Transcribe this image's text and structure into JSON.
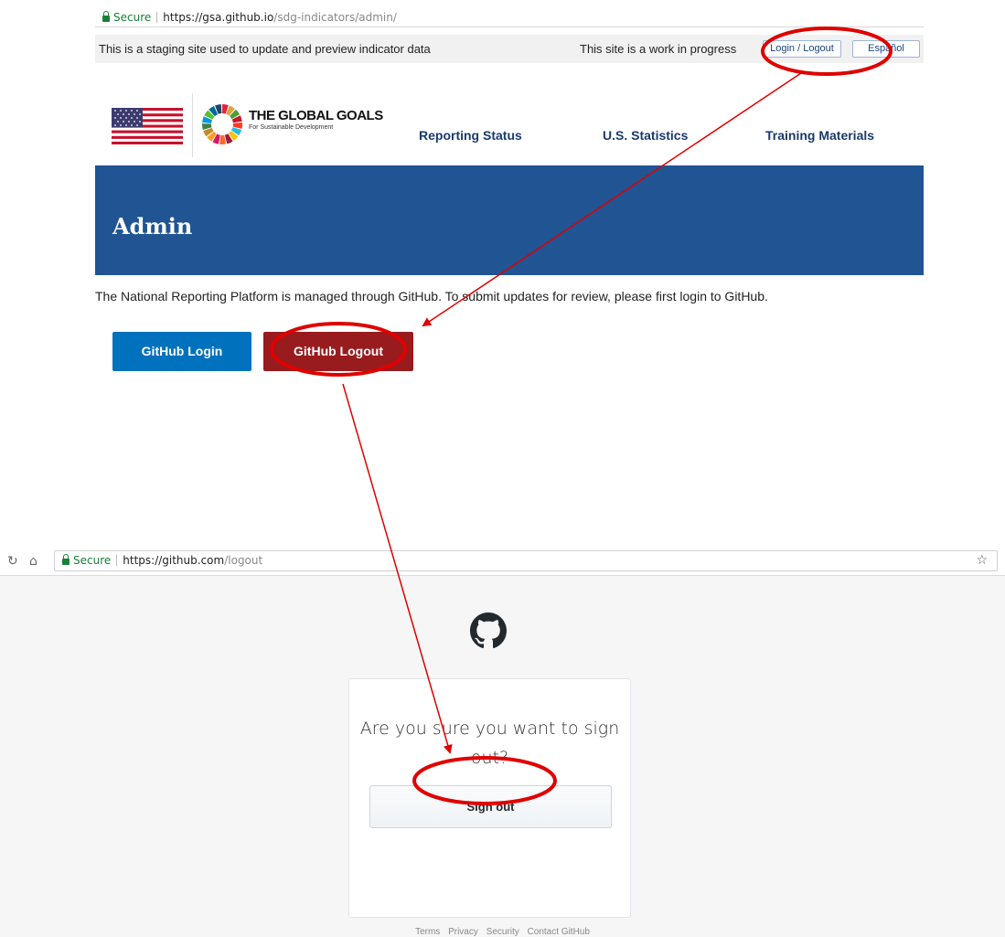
{
  "top_browser": {
    "secure_label": "Secure",
    "url_host": "https://gsa.github.io",
    "url_path": "/sdg-indicators/admin/"
  },
  "banner": {
    "staging_text": "This is a staging site used to update and preview indicator data",
    "progress_text": "This site is a work in progress",
    "login_logout_label": "Login / Logout",
    "espanol_label": "Español"
  },
  "header": {
    "goals_title": "THE GLOBAL GOALS",
    "goals_subtitle": "For Sustainable Development",
    "nav": [
      {
        "label": "Reporting Status"
      },
      {
        "label": "U.S. Statistics"
      },
      {
        "label": "Training Materials"
      }
    ]
  },
  "admin": {
    "title": "Admin",
    "description": "The National Reporting Platform is managed through GitHub. To submit updates for review, please first login to GitHub.",
    "login_button": "GitHub Login",
    "logout_button": "GitHub Logout"
  },
  "bottom_browser": {
    "secure_label": "Secure",
    "url_host": "https://github.com",
    "url_path": "/logout"
  },
  "github": {
    "question": "Are you sure you want to sign out?",
    "signout_button": "Sign out",
    "footer_links": [
      "Terms",
      "Privacy",
      "Security",
      "Contact GitHub"
    ]
  },
  "colors": {
    "annotation_red": "#e00000",
    "admin_band": "#205493",
    "login_button": "#0071bc",
    "logout_button": "#981b1e"
  }
}
